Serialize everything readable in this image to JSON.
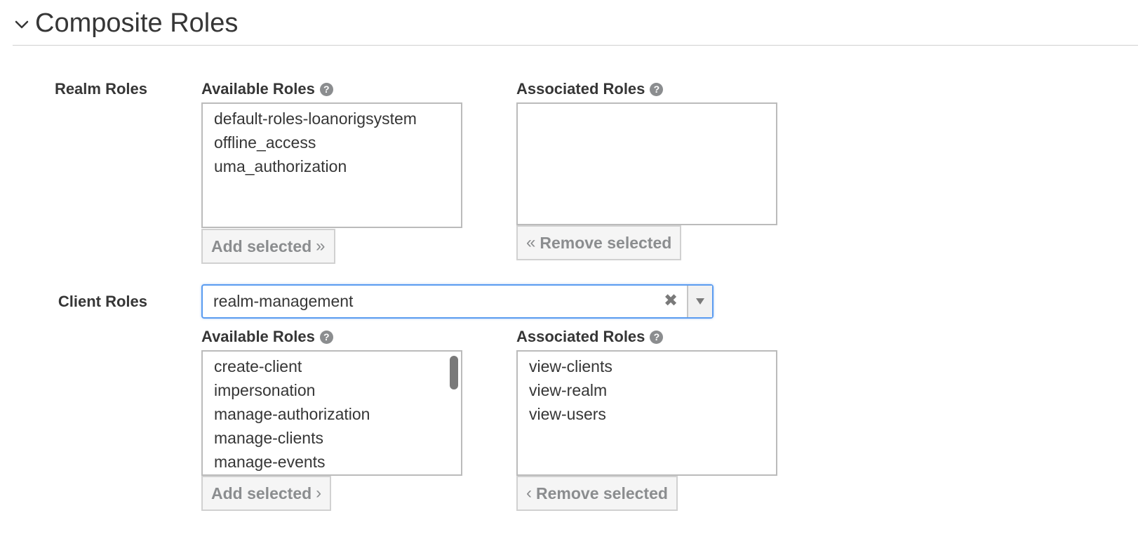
{
  "section": {
    "title": "Composite Roles"
  },
  "realm_roles": {
    "label": "Realm Roles",
    "available": {
      "label": "Available Roles",
      "items": [
        "default-roles-loanorigsystem",
        "offline_access",
        "uma_authorization"
      ],
      "button_label": "Add selected",
      "button_arrow": "»"
    },
    "associated": {
      "label": "Associated Roles",
      "items": [],
      "button_label": "Remove selected",
      "button_arrow": "«"
    }
  },
  "client_roles": {
    "label": "Client Roles",
    "selected_client": "realm-management",
    "clear_glyph": "✖",
    "available": {
      "label": "Available Roles",
      "items": [
        "create-client",
        "impersonation",
        "manage-authorization",
        "manage-clients",
        "manage-events"
      ],
      "button_label": "Add selected",
      "button_arrow": "›"
    },
    "associated": {
      "label": "Associated Roles",
      "items": [
        "view-clients",
        "view-realm",
        "view-users"
      ],
      "button_label": "Remove selected",
      "button_arrow": "‹"
    }
  },
  "help_glyph": "?",
  "colors": {
    "text": "#363636",
    "muted": "#8b8d8f",
    "focus_border": "#5b9cf0",
    "border": "#bbbbbb"
  }
}
